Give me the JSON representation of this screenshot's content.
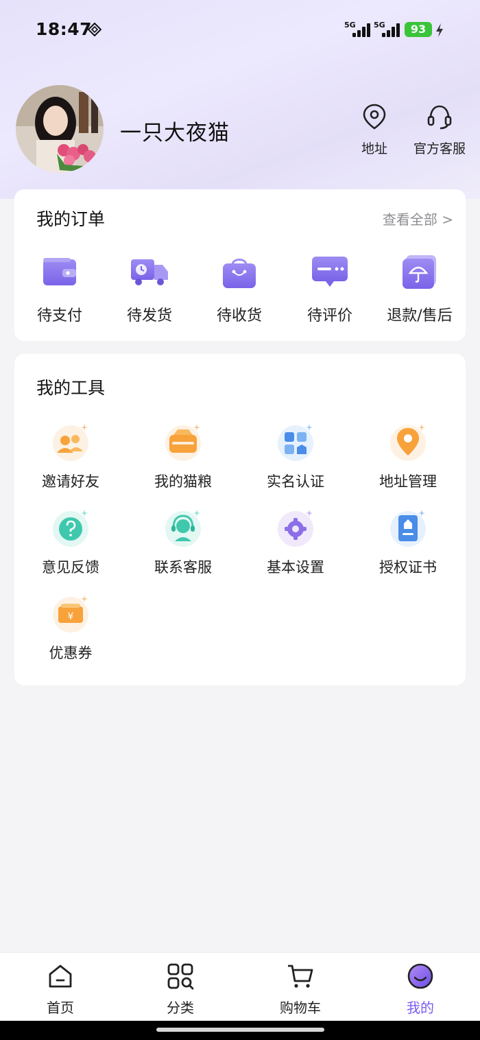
{
  "status": {
    "time": "18:47",
    "signal1": "5G",
    "signal2": "5G",
    "battery": "93"
  },
  "profile": {
    "username": "一只大夜猫"
  },
  "top_actions": [
    {
      "label": "地址",
      "icon": "location-pin-icon"
    },
    {
      "label": "官方客服",
      "icon": "headset-icon"
    }
  ],
  "orders": {
    "title": "我的订单",
    "view_all": "查看全部 >",
    "items": [
      {
        "label": "待支付",
        "icon": "wallet-icon"
      },
      {
        "label": "待发货",
        "icon": "delivery-truck-icon"
      },
      {
        "label": "待收货",
        "icon": "shopping-bag-icon"
      },
      {
        "label": "待评价",
        "icon": "comment-icon"
      },
      {
        "label": "退款/售后",
        "icon": "umbrella-box-icon"
      }
    ]
  },
  "tools": {
    "title": "我的工具",
    "items": [
      {
        "label": "邀请好友",
        "icon": "invite-friends-icon"
      },
      {
        "label": "我的猫粮",
        "icon": "cat-food-icon"
      },
      {
        "label": "实名认证",
        "icon": "verification-icon"
      },
      {
        "label": "地址管理",
        "icon": "address-management-icon"
      },
      {
        "label": "意见反馈",
        "icon": "feedback-icon"
      },
      {
        "label": "联系客服",
        "icon": "customer-service-icon"
      },
      {
        "label": "基本设置",
        "icon": "settings-gear-icon"
      },
      {
        "label": "授权证书",
        "icon": "certificate-icon"
      },
      {
        "label": "优惠券",
        "icon": "coupon-icon"
      }
    ]
  },
  "tabbar": [
    {
      "label": "首页",
      "icon": "home-icon"
    },
    {
      "label": "分类",
      "icon": "category-icon"
    },
    {
      "label": "购物车",
      "icon": "cart-icon"
    },
    {
      "label": "我的",
      "icon": "profile-icon",
      "active": true
    }
  ],
  "colors": {
    "accent": "#7a5cf0",
    "icon_purple": "#8c78ef",
    "battery": "#3ac43a",
    "orange": "#f7a23a"
  }
}
